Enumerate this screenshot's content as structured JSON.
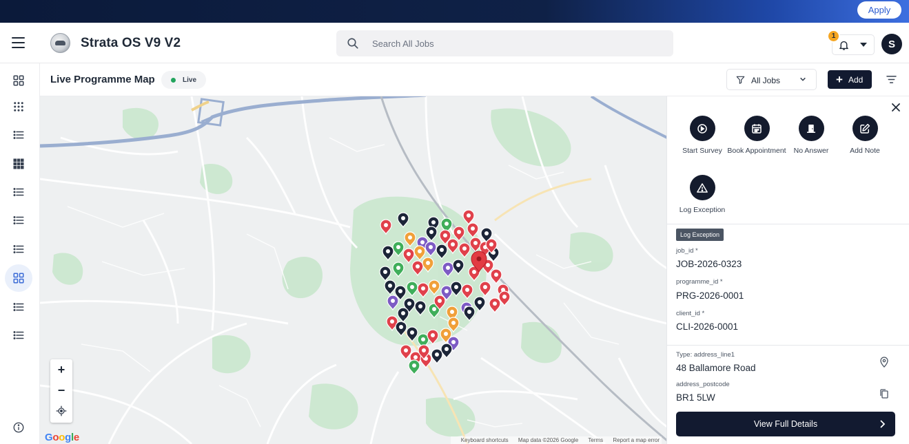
{
  "topbar": {
    "apply_label": "Apply"
  },
  "header": {
    "app_title": "Strata OS V9 V2",
    "search_placeholder": "Search All Jobs",
    "notification_count": "1",
    "avatar_initial": "S"
  },
  "sidebar": {
    "items": [
      {
        "icon": "dashboard-grid-icon",
        "active": false
      },
      {
        "icon": "dots-grid-icon",
        "active": false
      },
      {
        "icon": "list-icon",
        "active": false
      },
      {
        "icon": "apps-grid-icon",
        "active": false
      },
      {
        "icon": "list-icon",
        "active": false
      },
      {
        "icon": "list-icon",
        "active": false
      },
      {
        "icon": "list-icon",
        "active": false
      },
      {
        "icon": "dashboard-grid-icon",
        "active": true
      },
      {
        "icon": "list-icon",
        "active": false
      },
      {
        "icon": "list-icon",
        "active": false
      }
    ],
    "info_icon": "info-icon"
  },
  "subheader": {
    "page_title": "Live Programme Map",
    "live_label": "Live",
    "filter_value": "All Jobs",
    "add_label": "Add"
  },
  "map": {
    "zoom_in": "+",
    "zoom_out": "−",
    "attribution": {
      "shortcuts": "Keyboard shortcuts",
      "map_data": "Map data ©2026 Google",
      "terms": "Terms",
      "report": "Report a map error"
    },
    "pin_colors": {
      "navy": "#1c2538",
      "red": "#e0414b",
      "green": "#3fae5a",
      "purple": "#7d5bc4",
      "orange": "#f0a03a"
    }
  },
  "panel": {
    "actions": [
      {
        "label": "Start Survey",
        "icon": "play-circle-icon"
      },
      {
        "label": "Book Appointment",
        "icon": "calendar-icon"
      },
      {
        "label": "No Answer",
        "icon": "door-icon"
      },
      {
        "label": "Add Note",
        "icon": "edit-note-icon"
      },
      {
        "label": "Log Exception",
        "icon": "warning-icon"
      }
    ],
    "form_tag": "Log Exception",
    "fields": {
      "job_id_label": "job_id *",
      "job_id_value": "JOB-2026-0323",
      "programme_id_label": "programme_id *",
      "programme_id_value": "PRG-2026-0001",
      "client_id_label": "client_id *",
      "client_id_value": "CLI-2026-0001",
      "address_type_label": "Type: address_line1",
      "address_value": "48 Ballamore Road",
      "postcode_label": "address_postcode",
      "postcode_value": "BR1 5LW"
    },
    "details_button": "View Full Details"
  }
}
